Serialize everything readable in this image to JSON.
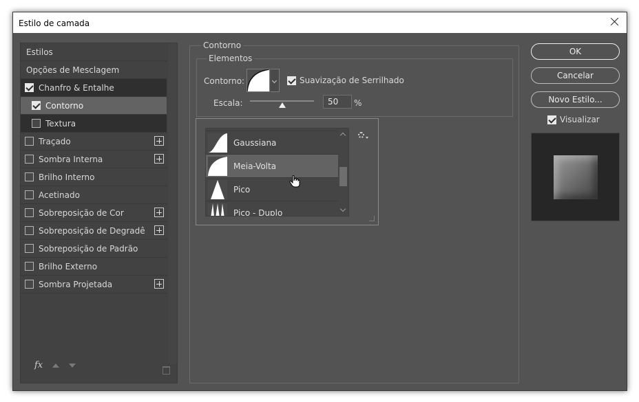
{
  "window": {
    "title": "Estilo de camada"
  },
  "styles": {
    "header": "Estilos",
    "blending": "Opções de Mesclagem",
    "items": [
      {
        "label": "Chanfro & Entalhe",
        "checked": true
      },
      {
        "label": "Contorno",
        "checked": true
      },
      {
        "label": "Textura",
        "checked": false
      },
      {
        "label": "Traçado",
        "checked": false
      },
      {
        "label": "Sombra Interna",
        "checked": false
      },
      {
        "label": "Brilho Interno",
        "checked": false
      },
      {
        "label": "Acetinado",
        "checked": false
      },
      {
        "label": "Sobreposição de Cor",
        "checked": false
      },
      {
        "label": "Sobreposição de Degradê",
        "checked": false
      },
      {
        "label": "Sobreposição de Padrão",
        "checked": false
      },
      {
        "label": "Brilho Externo",
        "checked": false
      },
      {
        "label": "Sombra Projetada",
        "checked": false
      }
    ],
    "footer": {
      "fx_label": "fx"
    }
  },
  "contour": {
    "group_title": "Contorno",
    "elements_title": "Elementos",
    "contour_label": "Contorno:",
    "antialias_label": "Suavização de Serrilhado",
    "antialias_checked": true,
    "scale_label": "Escala:",
    "scale_value": "50",
    "scale_unit": "%",
    "scale_fraction": 0.5,
    "presets": [
      "Gaussiana",
      "Meia-Volta",
      "Pico",
      "Pico - Duplo"
    ],
    "hovered_preset": "Meia-Volta"
  },
  "actions": {
    "ok": "OK",
    "cancel": "Cancelar",
    "new_style": "Novo Estilo...",
    "preview_label": "Visualizar",
    "preview_checked": true
  },
  "icons": {
    "close": "close-icon",
    "gear": "gear-icon",
    "plus": "plus-icon",
    "trash": "trash-icon",
    "arrow_up": "arrow-up-icon",
    "arrow_down": "arrow-down-icon"
  }
}
